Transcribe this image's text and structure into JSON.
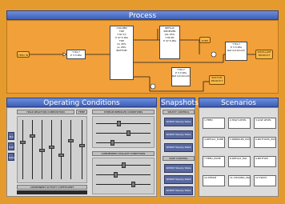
{
  "header": {
    "process_title": "Process",
    "operating_title": "Operating Conditions",
    "snapshots_title": "Snapshots",
    "scenarios_title": "Scenarios"
  },
  "process": {
    "column_block": [
      "COLUMN",
      "TOP",
      "T 87.1C",
      "P 47.5 kPa",
      "TOP",
      "UL 45%",
      "LL 26%",
      "BOTTOM"
    ],
    "top_right_block": [
      "REFLUX",
      "RECEIVER",
      "LVL 45%",
      "T 65.8C",
      "P 47.5 kPa"
    ],
    "feed_tag": "FEED IN",
    "feed_box": [
      "T 84.7",
      "P 3.3 kPa"
    ],
    "right_tag": [
      "DISTILLATE",
      "PRODUCT"
    ],
    "right_box": [
      "T 84.7",
      "P 3.3 kPa",
      "Ref 4.9 kmol/h"
    ],
    "bottom_center_box": [
      "T 84.7",
      "P 3.3 kPa",
      "Ref 4.9 kmol/h"
    ],
    "bottom_tag": [
      "BOTTOM",
      "PRODUCT"
    ],
    "small_tag": "PUMP"
  },
  "operating": {
    "col1_label": "HOLD REACTION COMPOSITION",
    "col2_label": "TEMP",
    "mid_label": "STREAM REBOILER CONDITIONS",
    "mid_label2": "CONDENSER COOLANT CONDITIONS",
    "bottom_label": "COMPONENT ACTIVITY COEFFICIENT",
    "left_buttons": [
      "Std",
      "Unit",
      "Data"
    ]
  },
  "snapshots": {
    "group1": "SELECT CONTROL",
    "group2": "SAVE CONTROL",
    "buttons": [
      "SIMPLE Steady State",
      "SIMPLE Steady State",
      "SIMPLE Steady State",
      "SIMPLE Steady State",
      "SIMPLE Steady State",
      "SIMPLE Steady State"
    ]
  },
  "scenarios": {
    "items": [
      "1.FEED",
      "2.HIGH LEVEL",
      "3.LOW LEVEL",
      "4.REFLUX_PUMP",
      "5.REBOILER_PUMP",
      "6.BOTTOMS_PUMP",
      "7.FEED_PUMP",
      "8.REFLUX_FAIL",
      "9.BOTTOM",
      "10.STEAM",
      "11.COOLING_WATER",
      "12.TRAYS"
    ]
  },
  "colors": {
    "background": "#e59a2e",
    "header": "#3d5fb8",
    "pipe": "#222222",
    "orange_box": "#f6b84a"
  }
}
